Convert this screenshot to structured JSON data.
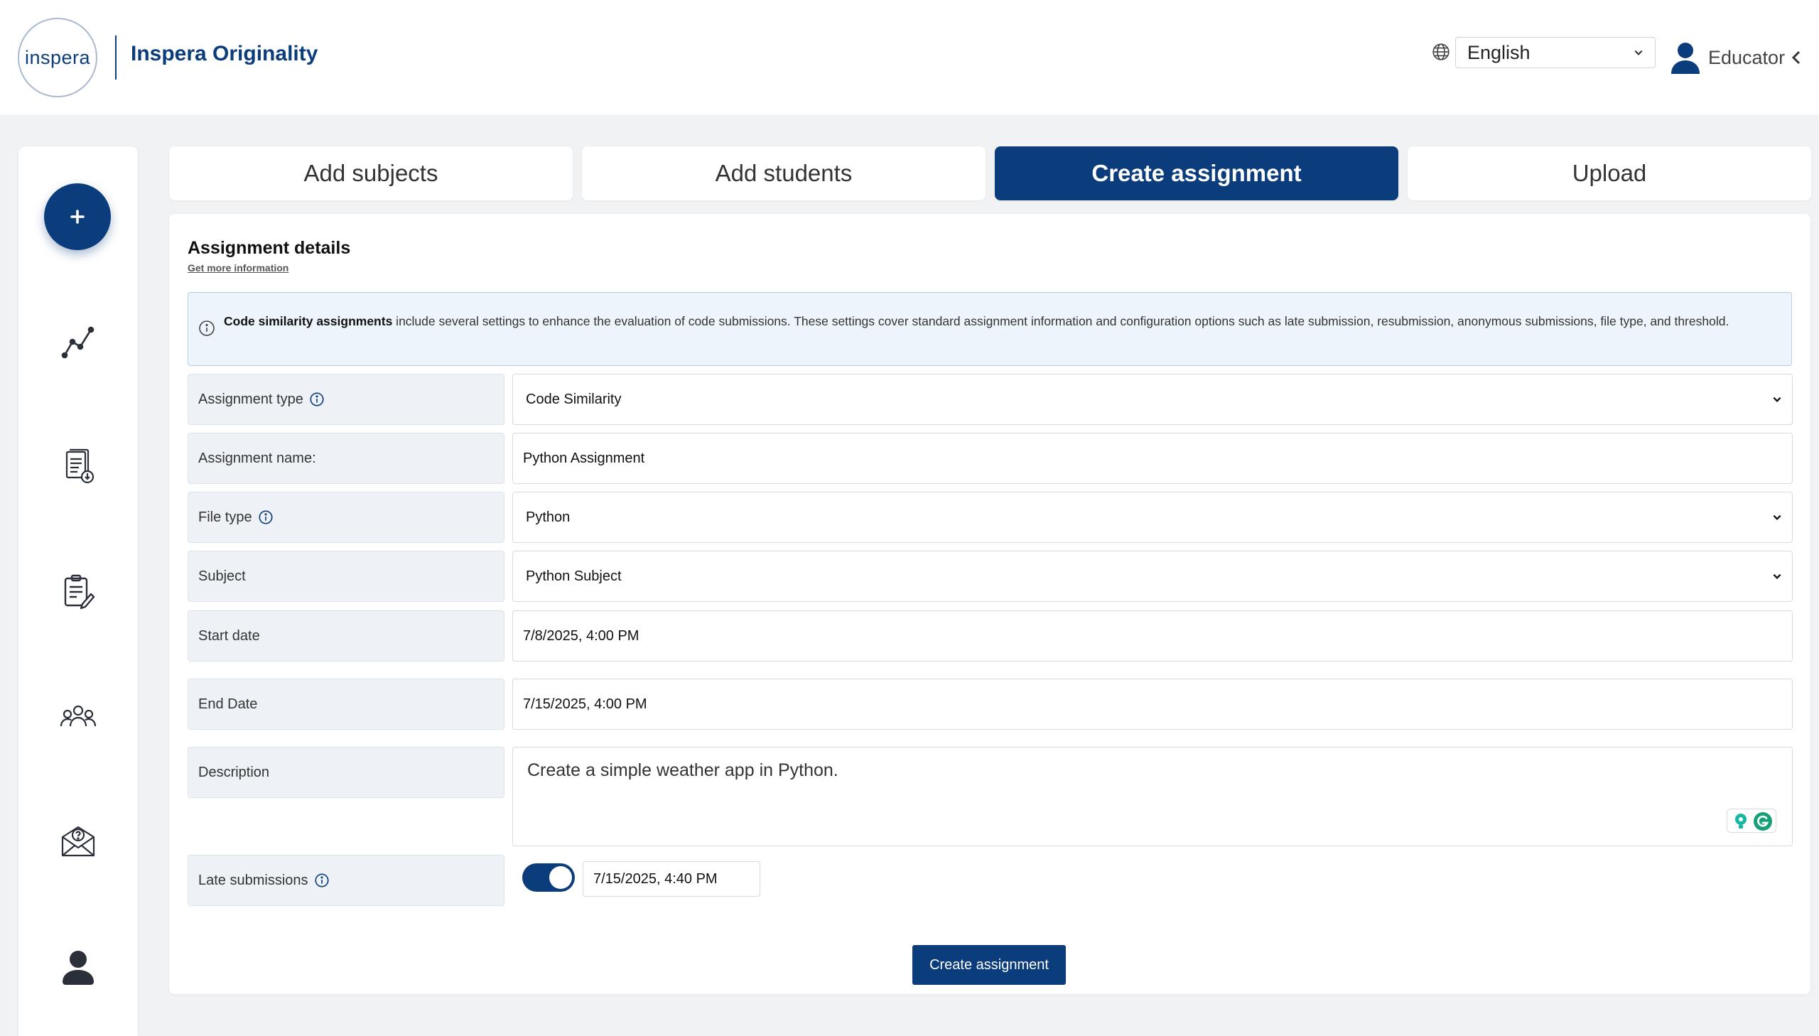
{
  "header": {
    "logo_text": "inspera",
    "app_title": "Inspera Originality",
    "language": "English",
    "role": "Educator"
  },
  "sidebar": {
    "icons": [
      "add-icon",
      "analytics-icon",
      "document-icon",
      "edit-document-icon",
      "group-icon",
      "mail-help-icon",
      "user-icon"
    ]
  },
  "tabs": [
    {
      "label": "Add subjects",
      "active": false
    },
    {
      "label": "Add students",
      "active": false
    },
    {
      "label": "Create assignment",
      "active": true
    },
    {
      "label": "Upload",
      "active": false
    }
  ],
  "assignment": {
    "title": "Assignment details",
    "more_link": "Get more information",
    "info_bold": "Code similarity assignments",
    "info_text": " include several settings to enhance the evaluation of code submissions. These settings cover standard assignment information and configuration options such as late submission, resubmission, anonymous submissions, file type, and threshold.",
    "fields": {
      "type": {
        "label": "Assignment type",
        "value": "Code Similarity"
      },
      "name": {
        "label": "Assignment name:",
        "value": "Python Assignment"
      },
      "file_type": {
        "label": "File type",
        "value": "Python"
      },
      "subject": {
        "label": "Subject",
        "value": "Python Subject"
      },
      "start": {
        "label": "Start date",
        "value": "7/8/2025, 4:00 PM"
      },
      "end": {
        "label": "End Date",
        "value": "7/15/2025, 4:00 PM"
      },
      "description": {
        "label": "Description",
        "value": "Create a simple weather app in Python."
      },
      "late": {
        "label": "Late submissions",
        "enabled": true,
        "value": "7/15/2025, 4:40 PM"
      }
    },
    "submit_label": "Create assignment"
  },
  "colors": {
    "brand": "#0b3c7c",
    "background": "#f1f2f4",
    "info_bg": "#eef4fb"
  }
}
